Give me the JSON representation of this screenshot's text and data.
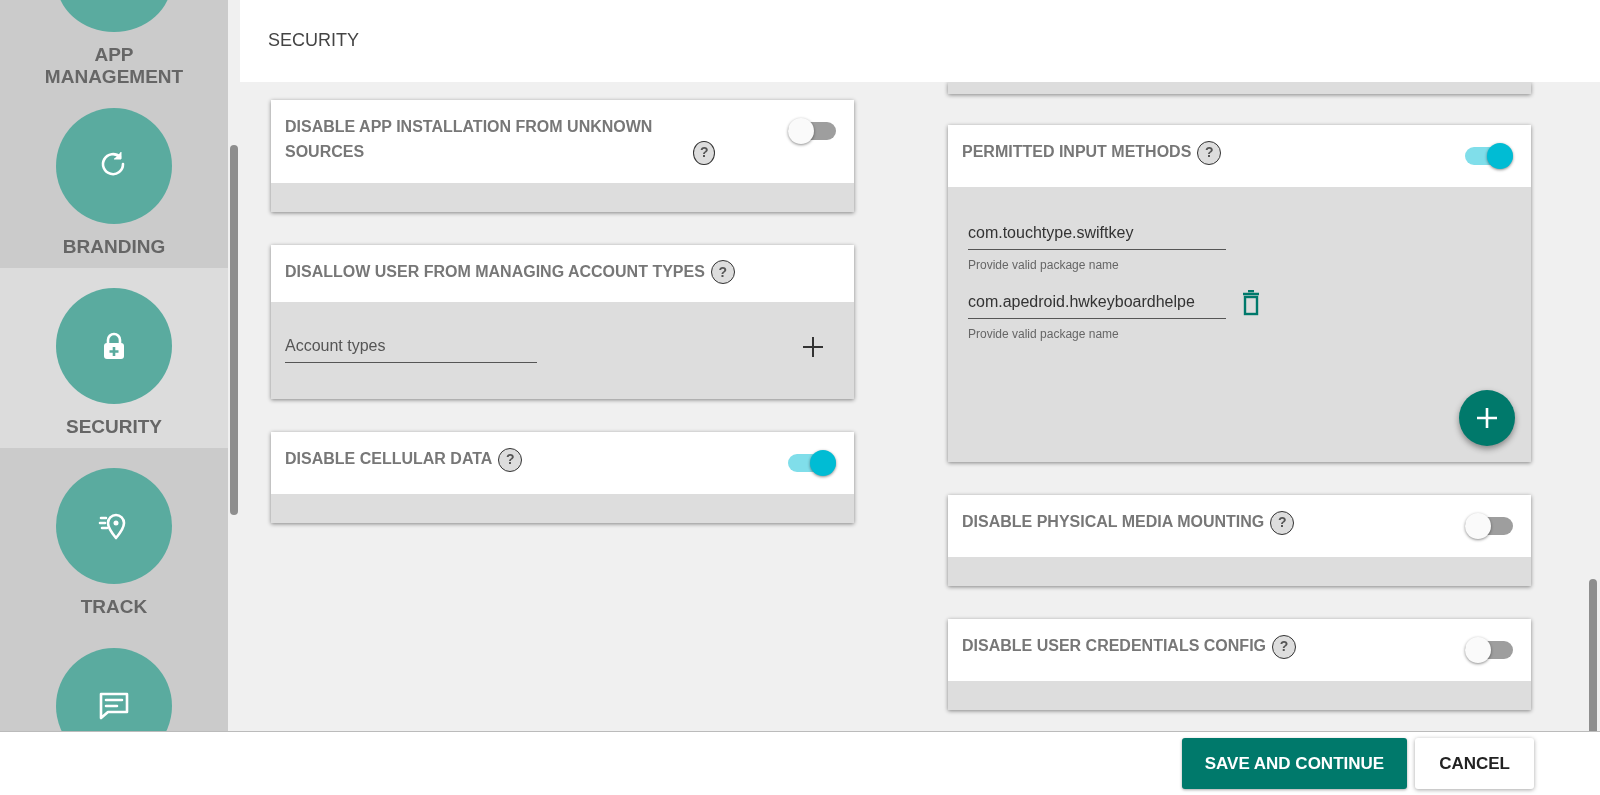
{
  "sidebar": {
    "items": [
      {
        "label": "APP MANAGEMENT",
        "selected": false
      },
      {
        "label": "BRANDING",
        "selected": false
      },
      {
        "label": "SECURITY",
        "selected": true
      },
      {
        "label": "TRACK",
        "selected": false
      },
      {
        "selected": false
      }
    ]
  },
  "header": {
    "title": "SECURITY"
  },
  "left_cards": [
    {
      "kind": "toggle",
      "title": "DISABLE APP INSTALLATION FROM UNKNOWN SOURCES",
      "help": "?",
      "on": false
    },
    {
      "kind": "account_types",
      "title": "DISALLOW USER FROM MANAGING ACCOUNT TYPES",
      "help": "?",
      "placeholder": "Account types"
    },
    {
      "kind": "toggle",
      "title": "DISABLE CELLULAR DATA",
      "help": "?",
      "on": true
    }
  ],
  "right_cards": [
    {
      "kind": "cut"
    },
    {
      "kind": "input_methods",
      "title": "PERMITTED INPUT METHODS",
      "help": "?",
      "on": true,
      "entries": [
        {
          "value": "com.touchtype.swiftkey",
          "hint": "Provide valid package name",
          "deletable": false
        },
        {
          "value": "com.apedroid.hwkeyboardhelpe",
          "hint": "Provide valid package name",
          "deletable": true
        }
      ]
    },
    {
      "kind": "toggle",
      "title": "DISABLE PHYSICAL MEDIA MOUNTING",
      "help": "?",
      "on": false
    },
    {
      "kind": "toggle",
      "title": "DISABLE USER CREDENTIALS CONFIG",
      "help": "?",
      "on": false
    }
  ],
  "footer": {
    "buttons": [
      {
        "label": "SAVE AND CONTINUE",
        "kind": "primary"
      },
      {
        "label": "CANCEL",
        "kind": "secondary"
      }
    ]
  }
}
